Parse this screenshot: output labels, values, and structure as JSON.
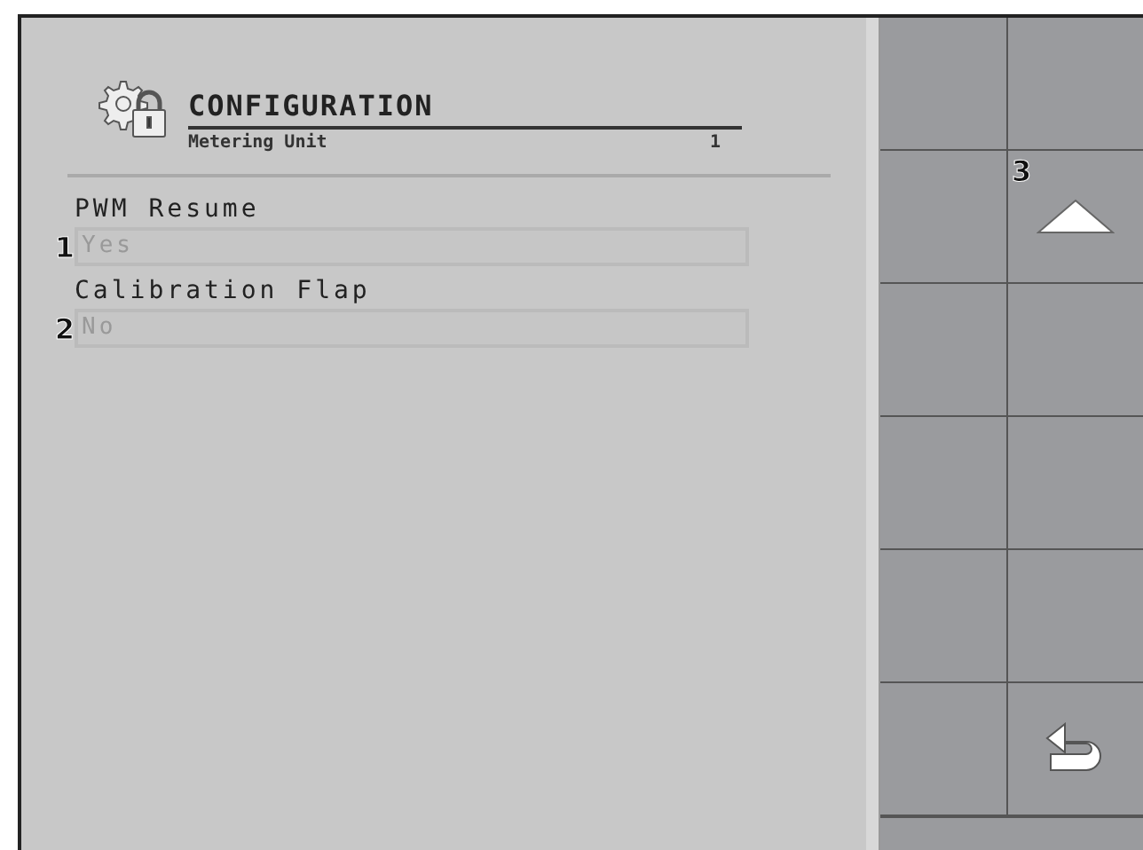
{
  "header": {
    "title": "CONFIGURATION",
    "subtitle": "Metering Unit",
    "number": "1"
  },
  "fields": [
    {
      "label": "PWM Resume",
      "value": "Yes",
      "callout": "1",
      "disabled": true
    },
    {
      "label": "Calibration Flap",
      "value": "No",
      "callout": "2",
      "disabled": true
    }
  ],
  "softkeys": [
    {
      "kind": "empty"
    },
    {
      "kind": "empty"
    },
    {
      "kind": "empty"
    },
    {
      "kind": "up",
      "callout": "3"
    },
    {
      "kind": "empty"
    },
    {
      "kind": "empty"
    },
    {
      "kind": "empty"
    },
    {
      "kind": "empty"
    },
    {
      "kind": "empty"
    },
    {
      "kind": "empty"
    },
    {
      "kind": "empty"
    },
    {
      "kind": "back"
    }
  ]
}
